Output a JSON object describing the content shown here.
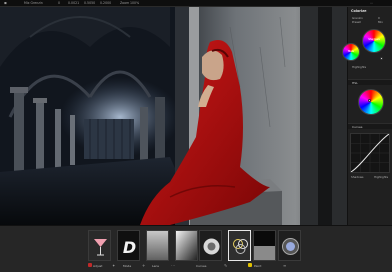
{
  "toolbar": {
    "left_label": "Mix Grenzin",
    "fields": [
      "0",
      "0.0021",
      "0.5050",
      "0.2000"
    ],
    "zoom_label": "Zoom",
    "zoom_value": "100%",
    "right_hint": "..."
  },
  "right_panel": {
    "title": "Colorize",
    "rows": [
      {
        "label": "Grenzin",
        "value": "0"
      },
      {
        "label": "Preset",
        "value": "Mix"
      }
    ],
    "wheels": [
      {
        "label": "Shadows"
      },
      {
        "label": "Mids"
      },
      {
        "label": "Highlights"
      }
    ],
    "sections": [
      "HSL",
      "Curves"
    ],
    "bottom_labels": [
      "Shadows",
      "Highlights"
    ],
    "colors": {
      "panel": "#202020",
      "accent_red": "#e04040",
      "accent_yellow": "#f0d000"
    }
  },
  "filmstrip": {
    "items": [
      {
        "caption": "Adjust",
        "swatch": "#c02a2a"
      },
      {
        "caption": "Mode",
        "swatch": "#7a7a7a"
      },
      {
        "caption": "Lens",
        "swatch": "#7a7a7a"
      },
      {
        "caption": "Curves",
        "swatch": "#7a7a7a"
      },
      {
        "caption": "Paint",
        "swatch": "#e0c000"
      }
    ],
    "tool_icons": [
      "star-icon",
      "plus-icon",
      "more-icon",
      "brush-icon",
      "menu-icon"
    ]
  }
}
